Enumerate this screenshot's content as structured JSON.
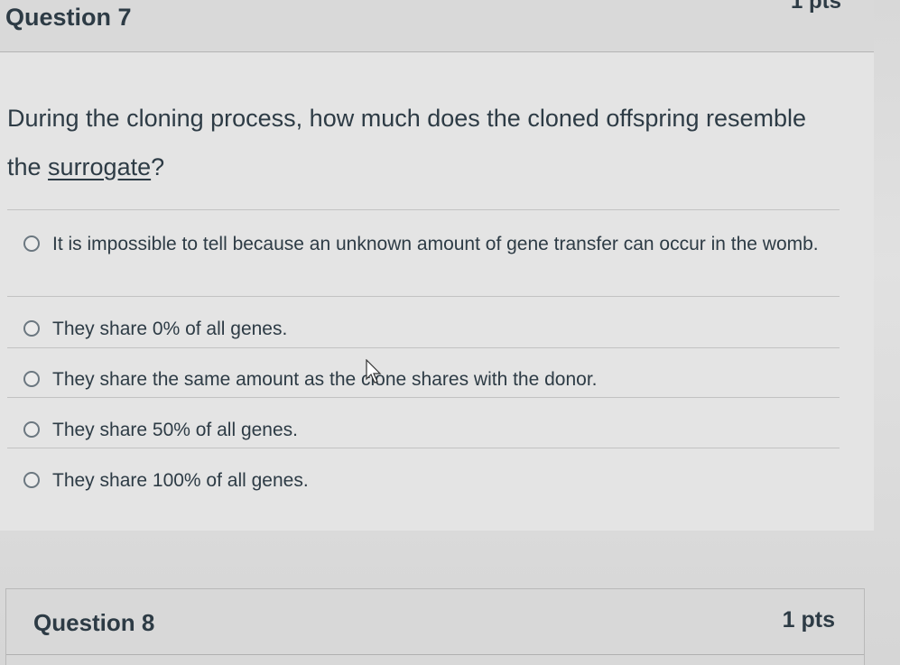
{
  "question7": {
    "title": "Question 7",
    "points": "1 pts",
    "prompt_before": "During the cloning process, how much does the cloned offspring resemble the ",
    "prompt_link": "surrogate",
    "prompt_after": "?",
    "answers": [
      {
        "label": "It is impossible to tell because an unknown amount of gene transfer can occur in the womb.",
        "selected": false
      },
      {
        "label": "They share 0% of all genes.",
        "selected": false
      },
      {
        "label": "They share the same amount as the clone shares with the donor.",
        "selected": false
      },
      {
        "label": "They share 50% of all genes.",
        "selected": false
      },
      {
        "label": "They share 100% of all genes.",
        "selected": false
      }
    ]
  },
  "question8": {
    "title": "Question 8",
    "points": "1 pts"
  },
  "colors": {
    "text": "#2d3b45",
    "background": "#e4e4e4",
    "radio_border": "#6b7780"
  }
}
